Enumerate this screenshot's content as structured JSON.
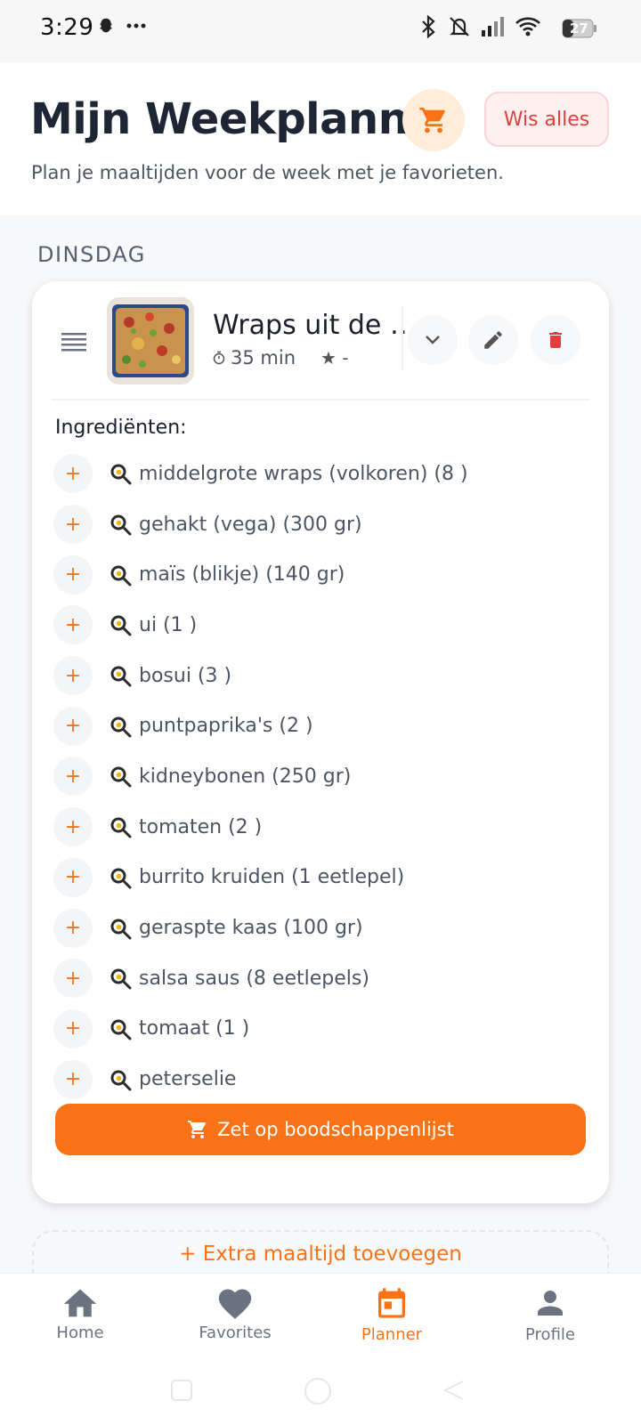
{
  "status_bar": {
    "time": "3:29",
    "battery": "27"
  },
  "header": {
    "title": "Mijn Weekplanner",
    "clear_label": "Wis alles",
    "subtitle": "Plan je maaltijden voor de week met je favorieten."
  },
  "day": {
    "label": "DINSDAG"
  },
  "meal": {
    "name": "Wraps uit de …",
    "time": "35 min",
    "rating": "★ -",
    "ingredients_title": "Ingrediënten:",
    "ingredients": [
      "middelgrote wraps (volkoren) (8 )",
      "gehakt (vega) (300 gr)",
      "maïs (blikje) (140 gr)",
      "ui (1 )",
      "bosui (3 )",
      "puntpaprika's (2 )",
      "kidneybonen (250 gr)",
      "tomaten (2 )",
      "burrito kruiden (1 eetlepel)",
      "geraspte kaas (100 gr)",
      "salsa saus (8 eetlepels)",
      "tomaat (1 )",
      "peterselie"
    ],
    "plus_symbol": "+",
    "shopping_label": "Zet op boodschappenlijst"
  },
  "add_meal": {
    "label": "+ Extra maaltijd toevoegen"
  },
  "nav": {
    "items": [
      {
        "label": "Home",
        "icon": "home-icon"
      },
      {
        "label": "Favorites",
        "icon": "heart-icon"
      },
      {
        "label": "Planner",
        "icon": "calendar-icon",
        "active": true
      },
      {
        "label": "Profile",
        "icon": "person-icon"
      }
    ]
  },
  "colors": {
    "accent": "#f97316",
    "danger": "#e53e3e",
    "text": "#1e2535"
  }
}
